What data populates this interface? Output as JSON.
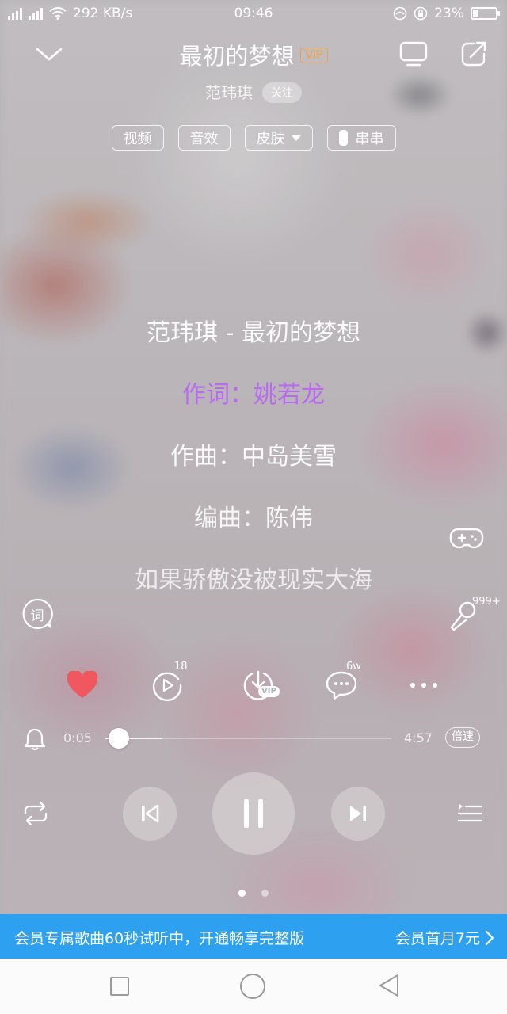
{
  "status_bar": {
    "network_speed": "292 KB/s",
    "time": "09:46",
    "battery": "23%",
    "battery_level": 0.23,
    "sim1_label": "3G",
    "sim2_label": "3G"
  },
  "header": {
    "song_title": "最初的梦想",
    "vip_tag": "VIP",
    "artist": "范玮琪",
    "follow_label": "关注"
  },
  "chips": {
    "video": "视频",
    "sound_effect": "音效",
    "skin": "皮肤",
    "chuanchuan": "串串"
  },
  "lyrics": [
    "范玮琪 - 最初的梦想",
    "作词：姚若龙",
    "作曲：中岛美雪",
    "编曲：陈伟",
    "如果骄傲没被现实大海"
  ],
  "side": {
    "lyrics_button": "词",
    "mic_count": "999+"
  },
  "actions": {
    "mv_count": "18",
    "download_vip": "VIP",
    "comment_count": "6w"
  },
  "progress": {
    "current": "0:05",
    "total": "4:57",
    "played_fraction": 0.05,
    "buffered_fraction": 0.2,
    "speed_label": "倍速"
  },
  "pager": {
    "pages": 2,
    "active": 0
  },
  "vip_banner": {
    "message": "会员专属歌曲60秒试听中，开通畅享完整版",
    "offer": "会员首月7元"
  },
  "colors": {
    "accent_purple": "#b86bf0",
    "heart_red": "#f0575f",
    "vip_orange": "#f0a040",
    "banner_blue": "#2ea0f0"
  }
}
